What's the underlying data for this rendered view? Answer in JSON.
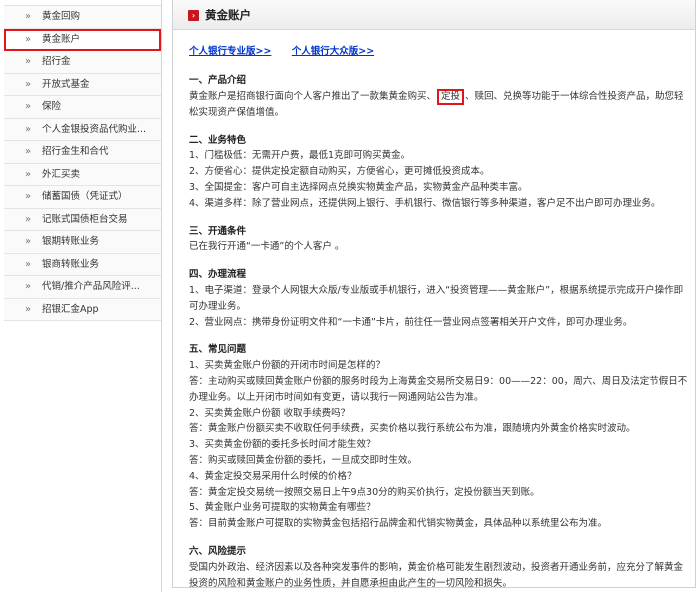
{
  "sidebar": {
    "items": [
      {
        "label": "黄金回购"
      },
      {
        "label": "黄金账户",
        "active": true
      },
      {
        "label": "招行金"
      },
      {
        "label": "开放式基金"
      },
      {
        "label": "保险"
      },
      {
        "label": "个人金银投资品代购业..."
      },
      {
        "label": "招行金生和合代"
      },
      {
        "label": "外汇买卖"
      },
      {
        "label": "储蓄国债（凭证式）"
      },
      {
        "label": "记账式国债柜台交易"
      },
      {
        "label": "银期转账业务"
      },
      {
        "label": "银商转账业务"
      },
      {
        "label": "代销/推介产品风险评..."
      },
      {
        "label": "招银汇金App"
      }
    ]
  },
  "header": {
    "title": "黄金账户"
  },
  "links": {
    "pro": "个人银行专业版>>",
    "public": "个人银行大众版>>"
  },
  "sections": {
    "intro_title": "一、产品介绍",
    "intro_a": "黄金账户是招商银行面向个人客户推出了一款集黄金购买、",
    "intro_hl": "定投",
    "intro_b": "、赎回、兑换等功能于一体综合性投资产品，助您轻松实现资产保值增值。",
    "features_title": "二、业务特色",
    "f1": "1、门槛极低：无需开户费，最低1克即可购买黄金。",
    "f2": "2、方便省心：提供定投定额自动购买，方便省心，更可摊低投资成本。",
    "f3": "3、全国提金：客户可自主选择网点兑换实物黄金产品，实物黄金产品种类丰富。",
    "f4": "4、渠道多样：除了营业网点，还提供网上银行、手机银行、微信银行等多种渠道，客户足不出户即可办理业务。",
    "cond_title": "三、开通条件",
    "cond_text": "已在我行开通“一卡通”的个人客户 。",
    "proc_title": "四、办理流程",
    "p1": "1、电子渠道：登录个人网银大众版/专业版或手机银行，进入“投资管理——黄金账户”，根据系统提示完成开户操作即可办理业务。",
    "p2": "2、营业网点：携带身份证明文件和“一卡通”卡片，前往任一营业网点签署相关开户文件，即可办理业务。",
    "faq_title": "五、常见问题",
    "q1": "1、买卖黄金账户份额的开闭市时间是怎样的？",
    "a1": "答：主动购买或赎回黄金账户份额的服务时段为上海黄金交易所交易日9：00——22：00，周六、周日及法定节假日不办理业务。以上开闭市时间如有变更，请以我行一网通网站公告为准。",
    "q2": "2、买卖黄金账户份额 收取手续费吗？",
    "a2": "答：黄金账户份额买卖不收取任何手续费，买卖价格以我行系统公布为准，跟随境内外黄金价格实时波动。",
    "q3": "3、买卖黄金份额的委托多长时间才能生效？",
    "a3": "答：购买或赎回黄金份额的委托，一旦成交即时生效。",
    "q4": "4、黄金定投交易采用什么时候的价格？",
    "a4": "答：黄金定投交易统一按照交易日上午9点30分的购买价执行，定投份额当天到账。",
    "q5": "5、黄金账户业务可提取的实物黄金有哪些？",
    "a5": "答：目前黄金账户可提取的实物黄金包括招行品牌金和代销实物黄金，具体品种以系统里公布为准。",
    "risk_title": "六、风险提示",
    "risk_text": "受国内外政治、经济因素以及各种突发事件的影响，黄金价格可能发生剧烈波动，投资者开通业务前，应充分了解黄金投资的风险和黄金账户的业务性质，并自愿承担由此产生的一切风险和损失。"
  }
}
